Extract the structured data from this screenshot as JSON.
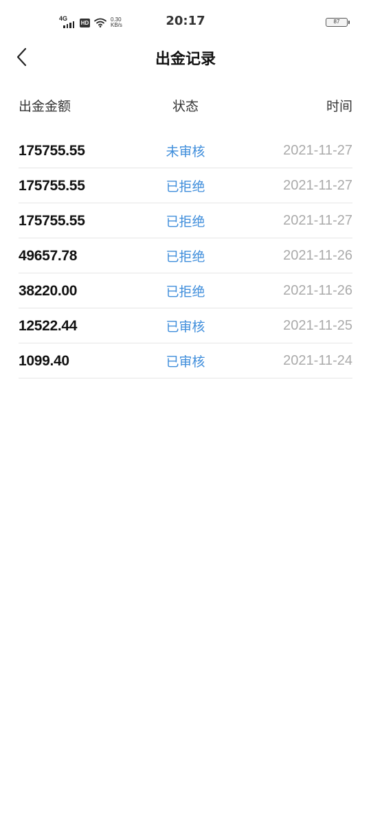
{
  "status_bar": {
    "network": "4G",
    "hd": "HD",
    "speed_value": "0.30",
    "speed_unit": "KB/s",
    "time": "20:17",
    "battery": "87"
  },
  "header": {
    "title": "出金记录"
  },
  "table": {
    "columns": {
      "amount": "出金金额",
      "status": "状态",
      "time": "时间"
    },
    "rows": [
      {
        "amount": "175755.55",
        "status": "未审核",
        "time": "2021-11-27"
      },
      {
        "amount": "175755.55",
        "status": "已拒绝",
        "time": "2021-11-27"
      },
      {
        "amount": "175755.55",
        "status": "已拒绝",
        "time": "2021-11-27"
      },
      {
        "amount": "49657.78",
        "status": "已拒绝",
        "time": "2021-11-26"
      },
      {
        "amount": "38220.00",
        "status": "已拒绝",
        "time": "2021-11-26"
      },
      {
        "amount": "12522.44",
        "status": "已审核",
        "time": "2021-11-25"
      },
      {
        "amount": "1099.40",
        "status": "已审核",
        "time": "2021-11-24"
      }
    ]
  },
  "colors": {
    "status_text": "#3e8ddb",
    "date_text": "#aaaaaa",
    "divider": "#e5e5e5"
  }
}
